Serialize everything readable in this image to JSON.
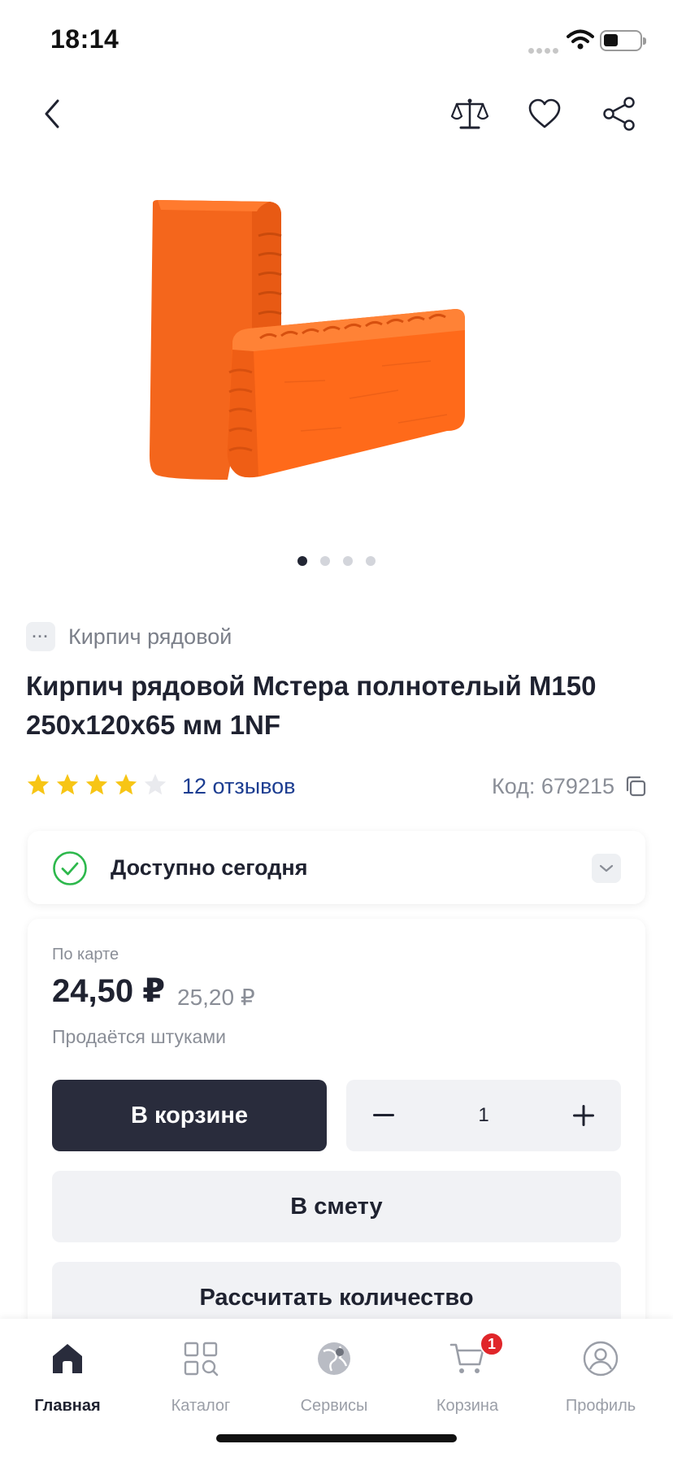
{
  "status_bar": {
    "time": "18:14"
  },
  "category": {
    "label": "Кирпич рядовой"
  },
  "product": {
    "title": "Кирпич рядовой Мстера полнотелый М150 250x120x65 мм 1NF",
    "rating": 4,
    "rating_max": 5,
    "reviews_label": "12 отзывов",
    "code_label": "Код: 679215"
  },
  "carousel": {
    "slides": 4,
    "active": 0
  },
  "availability": {
    "label": "Доступно сегодня"
  },
  "price": {
    "caption": "По карте",
    "current": "24,50 ₽",
    "old": "25,20 ₽",
    "sold_note": "Продаётся штуками"
  },
  "actions": {
    "in_cart_label": "В корзине",
    "quantity": "1",
    "estimate_label": "В смету",
    "calculate_label": "Рассчитать количество"
  },
  "tab_bar": {
    "items": [
      {
        "label": "Главная",
        "icon": "home-icon"
      },
      {
        "label": "Каталог",
        "icon": "catalog-icon"
      },
      {
        "label": "Сервисы",
        "icon": "services-icon"
      },
      {
        "label": "Корзина",
        "icon": "cart-icon"
      },
      {
        "label": "Профиль",
        "icon": "profile-icon"
      }
    ],
    "cart_badge": "1",
    "active": 0
  },
  "colors": {
    "accent_dark": "#292c3c",
    "link_blue": "#1c3d91",
    "star_yellow": "#f7c515",
    "success_green": "#2db84c",
    "badge_red": "#e0262a",
    "brick_orange": "#ff6a1a"
  }
}
